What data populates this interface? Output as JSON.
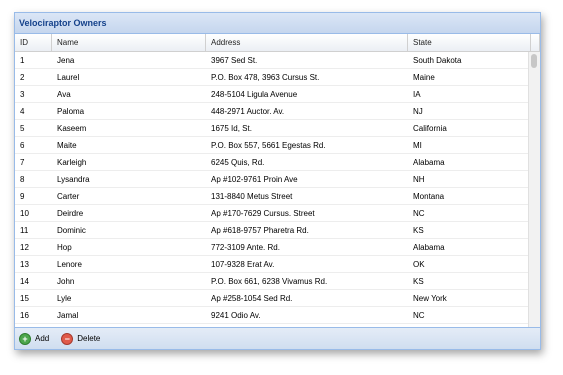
{
  "panel": {
    "title": "Velociraptor Owners"
  },
  "grid": {
    "columns": [
      "ID",
      "Name",
      "Address",
      "State"
    ],
    "rows": [
      [
        "1",
        "Jena",
        "3967 Sed St.",
        "South Dakota"
      ],
      [
        "2",
        "Laurel",
        "P.O. Box 478, 3963 Cursus St.",
        "Maine"
      ],
      [
        "3",
        "Ava",
        "248-5104 Ligula Avenue",
        "IA"
      ],
      [
        "4",
        "Paloma",
        "448-2971 Auctor. Av.",
        "NJ"
      ],
      [
        "5",
        "Kaseem",
        "1675 Id, St.",
        "California"
      ],
      [
        "6",
        "Maite",
        "P.O. Box 557, 5661 Egestas Rd.",
        "MI"
      ],
      [
        "7",
        "Karleigh",
        "6245 Quis, Rd.",
        "Alabama"
      ],
      [
        "8",
        "Lysandra",
        "Ap #102-9761 Proin Ave",
        "NH"
      ],
      [
        "9",
        "Carter",
        "131-8840 Metus Street",
        "Montana"
      ],
      [
        "10",
        "Deirdre",
        "Ap #170-7629 Cursus. Street",
        "NC"
      ],
      [
        "11",
        "Dominic",
        "Ap #618-9757 Pharetra Rd.",
        "KS"
      ],
      [
        "12",
        "Hop",
        "772-3109 Ante. Rd.",
        "Alabama"
      ],
      [
        "13",
        "Lenore",
        "107-9328 Erat Av.",
        "OK"
      ],
      [
        "14",
        "John",
        "P.O. Box 661, 6238 Vivamus Rd.",
        "KS"
      ],
      [
        "15",
        "Lyle",
        "Ap #258-1054 Sed Rd.",
        "New York"
      ],
      [
        "16",
        "Jamal",
        "9241 Odio Av.",
        "NC"
      ]
    ]
  },
  "toolbar": {
    "add_label": "Add",
    "delete_label": "Delete"
  },
  "icons": {
    "add": "add-icon",
    "delete": "delete-icon"
  },
  "colors": {
    "header_text": "#15428b",
    "border": "#99bbe8",
    "add": "#4ca64c",
    "delete": "#e05a4a"
  }
}
